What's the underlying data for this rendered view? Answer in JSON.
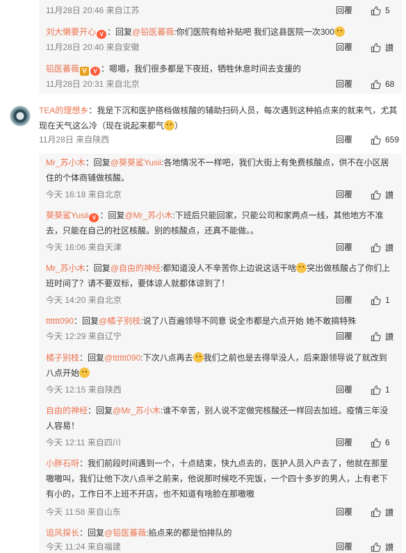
{
  "comments": [
    {
      "name": "",
      "text": "",
      "time": "11月28日 20:46 来自江苏",
      "reply_label": "回覆",
      "likes": "5"
    },
    {
      "name": "刘大懒要开心",
      "sep": "：回复",
      "mention": "@铅医蕃薇",
      "text": ":你们医院有给补贴吧 我们这县医院一次300",
      "time": "11月28日 20:40 来自安徽",
      "reply_label": "回覆",
      "likes": "讃"
    },
    {
      "name": "铅医蕃薇",
      "text": "：嗯嗯，我们很多都是下夜班，牺牲休息时间去支援的",
      "time": "11月28日 20:31 来自北京",
      "reply_label": "回覆",
      "likes": "68"
    }
  ],
  "main_comment": {
    "name": "TEA的理想乡",
    "text": "：我是下沉和医护搭档做核酸的辅助扫码人员，每次遇到这种掐点来的就来气，尤其现在天气这么冷（现在说起来都气",
    "text_end": "）",
    "time": "11月28日 来自陕西",
    "reply_label": "回覆",
    "likes": "659"
  },
  "replies": [
    {
      "name": "Mr_苏小木",
      "sep": "：回复",
      "mention": "@葵葵鲨Yusii",
      "text": ":各地情况不一样吧，我们大街上有免费核酸点，供不在小区居住的个体商铺做核酸。",
      "time": "今天 16:18 来自北京",
      "reply_label": "回覆",
      "likes": "讃"
    },
    {
      "name": "葵葵鲨Yusii",
      "sep": "：回复",
      "mention": "@Mr_苏小木",
      "text": ":下班后只能回家，只能公司和家两点一线，其他地方不准去，只能在自己的社区核酸。别的核酸点，还真不能做。。",
      "time": "今天 16:06 来自天津",
      "reply_label": "回覆",
      "likes": "讃"
    },
    {
      "name": "Mr_苏小木",
      "sep": "：回复",
      "mention": "@自由的神经",
      "text": ":都知道没人不辛苦你上边说这话干啥",
      "text2": "突出做核酸占了你们上班时间了？请不要双标，要体谅人就都体谅到了！",
      "time": "今天 14:20 来自北京",
      "reply_label": "回覆",
      "likes": "1"
    },
    {
      "name": "tttttt090",
      "sep": "：回复",
      "mention": "@橘子别枝",
      "text": ":说了八百遍领导不同意 说全市都是六点开始 她不敢搞特殊",
      "time": "今天 12:29 来自辽宁",
      "reply_label": "回覆",
      "likes": "讃"
    },
    {
      "name": "橘子别枝",
      "sep": "：回复",
      "mention": "@tttttt090",
      "text": ":下次八点再去",
      "text2": "我们之前也是去得早没人，后来跟领导说了就改到八点开始",
      "time": "今天 12:15 来自陕西",
      "reply_label": "回覆",
      "likes": "1"
    },
    {
      "name": "自由的神经",
      "sep": "：回复",
      "mention": "@Mr_苏小木",
      "text": ":谁不辛苦，别人说不定做完核酸还一样回去加班。疫情三年没人容易！",
      "time": "今天 12:11 来自四川",
      "reply_label": "回覆",
      "likes": "6"
    },
    {
      "name": "小胖石呀",
      "text": "：我们前段时间遇到一个，十点结束，快九点去的，医护人员入户去了，他就在那里嗷嗷叫，我们让他下次八点半之前来，他说那时候吃不完饭，一个四十多岁的男人，上有老下有小的，工作日不上班不开店，也不知道有啥脸在那嗷嗷",
      "time": "今天 11:58 来自山东",
      "reply_label": "回覆",
      "likes": "讃"
    },
    {
      "name": "追风探长",
      "sep": "：回复",
      "mention": "@铅医蕃薇",
      "text": ":掐点来的都是怕排队的",
      "time": "今天 11:24 来自福建",
      "reply_label": "回覆",
      "likes": "讃"
    }
  ],
  "colors": {
    "accent": "#eb7350",
    "meta": "#808080",
    "nested_bg": "#f6f6f6"
  }
}
